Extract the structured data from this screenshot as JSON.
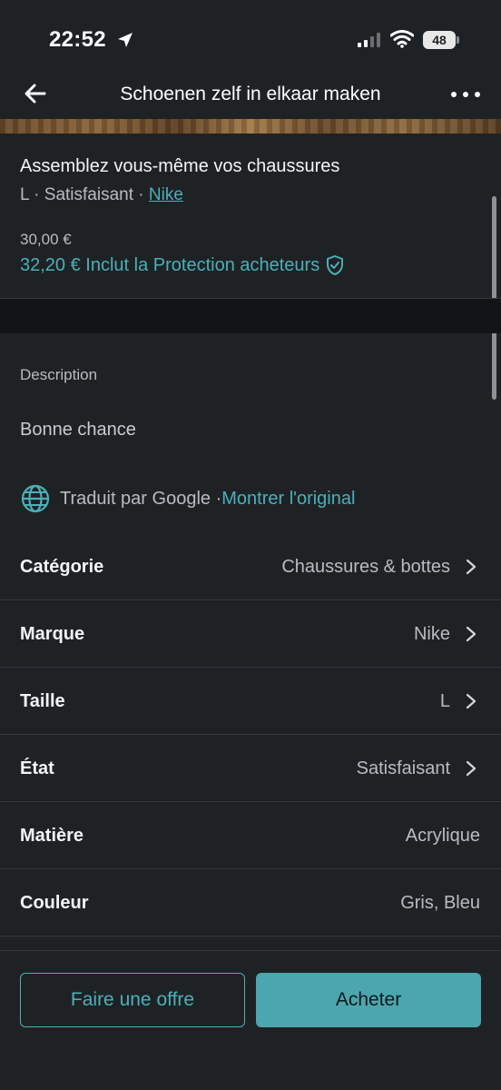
{
  "status_bar": {
    "time": "22:52",
    "battery": "48"
  },
  "nav": {
    "title": "Schoenen zelf in elkaar maken"
  },
  "item": {
    "title": "Assemblez vous-même vos chaussures",
    "size": "L",
    "separator": " · ",
    "condition": "Satisfaisant",
    "brand": "Nike",
    "price": "30,00 €",
    "total_price": "32,20 € Inclut la Protection acheteurs"
  },
  "description": {
    "label": "Description",
    "text": "Bonne chance",
    "translated_by": "Traduit par Google · ",
    "show_original": "Montrer l'original"
  },
  "attributes": [
    {
      "label": "Catégorie",
      "value": "Chaussures & bottes",
      "has_arrow": true
    },
    {
      "label": "Marque",
      "value": "Nike",
      "has_arrow": true
    },
    {
      "label": "Taille",
      "value": "L",
      "has_arrow": true
    },
    {
      "label": "État",
      "value": "Satisfaisant",
      "has_arrow": true
    },
    {
      "label": "Matière",
      "value": "Acrylique",
      "has_arrow": false
    },
    {
      "label": "Couleur",
      "value": "Gris, Bleu",
      "has_arrow": false
    }
  ],
  "actions": {
    "offer": "Faire une offre",
    "buy": "Acheter"
  },
  "colors": {
    "accent": "#4ab0b9",
    "background": "#1f2225",
    "button_fill": "#4ca6ae"
  }
}
